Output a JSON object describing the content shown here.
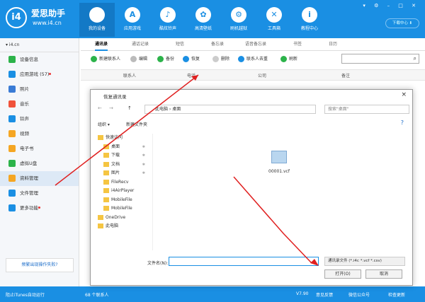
{
  "app": {
    "brand": "爱思助手",
    "url": "www.i4.cn",
    "logo": "i4",
    "download": "下载中心 ⬇",
    "window_controls": "▾ ⚙ – □ ✕"
  },
  "nav": [
    {
      "label": "我的设备",
      "icon": "apple-icon"
    },
    {
      "label": "应用游戏",
      "icon": "apps-icon"
    },
    {
      "label": "酷炫铃声",
      "icon": "bell-icon"
    },
    {
      "label": "高清壁纸",
      "icon": "wallpaper-icon"
    },
    {
      "label": "刷机越狱",
      "icon": "flash-icon"
    },
    {
      "label": "工具箱",
      "icon": "tools-icon"
    },
    {
      "label": "教程中心",
      "icon": "info-icon"
    }
  ],
  "sidebar": {
    "device": "▾ i4.cn",
    "help": "频繁出现操作失败?",
    "items": [
      {
        "label": "设备信息",
        "color": "#2cb34a"
      },
      {
        "label": "应用游戏 (57)",
        "color": "#1a8fe3",
        "dot": true
      },
      {
        "label": "照片",
        "color": "#3a7bd5"
      },
      {
        "label": "音乐",
        "color": "#f0523a"
      },
      {
        "label": "铃声",
        "color": "#1a8fe3"
      },
      {
        "label": "视频",
        "color": "#f5a623"
      },
      {
        "label": "电子书",
        "color": "#f5a623"
      },
      {
        "label": "虚拟U盘",
        "color": "#2cb34a"
      },
      {
        "label": "资料管理",
        "color": "#f5a623"
      },
      {
        "label": "文件管理",
        "color": "#1a8fe3"
      },
      {
        "label": "更多功能",
        "color": "#1a8fe3",
        "dot": true
      }
    ]
  },
  "tabs": [
    "通讯录",
    "通话记录",
    "短信",
    "备忘录",
    "语音备忘录",
    "书签",
    "日历"
  ],
  "toolbar": [
    "新建联系人",
    "编辑",
    "备份",
    "恢复",
    "删除",
    "联系人去重",
    "刷新"
  ],
  "table_headers": [
    "联系人",
    "电话",
    "公司",
    "备注"
  ],
  "status": {
    "itunes": "阻止iTunes自动运行",
    "count": "68 个联系人",
    "version": "V7.90",
    "feedback": "意见反馈",
    "wechat": "微信公众号",
    "update": "检查更新"
  },
  "dialog": {
    "title": "恢复通讯录",
    "path": "此电脑 › 桌面",
    "search_placeholder": "搜索\"桌面\"",
    "organize": "组织 ▾",
    "new_folder": "新建文件夹",
    "tree": [
      {
        "label": "快速访问",
        "icon": "star-icon"
      },
      {
        "label": "桌面",
        "icon": "desktop-icon",
        "pin": true
      },
      {
        "label": "下载",
        "icon": "download-icon",
        "pin": true
      },
      {
        "label": "文档",
        "icon": "document-icon",
        "pin": true
      },
      {
        "label": "图片",
        "icon": "picture-icon",
        "pin": true
      },
      {
        "label": "FileRecv",
        "icon": "folder-icon"
      },
      {
        "label": "i4AirPlayer",
        "icon": "folder-icon"
      },
      {
        "label": "MobileFile",
        "icon": "folder-icon"
      },
      {
        "label": "MobileFile",
        "icon": "folder-icon"
      },
      {
        "label": "OneDrive",
        "icon": "cloud-icon"
      },
      {
        "label": "此电脑",
        "icon": "pc-icon"
      }
    ],
    "file": "00001.vcf",
    "filename_label": "文件名(N):",
    "filetype": "通讯录文件 (*.i4c *.vcf *.csv)",
    "open": "打开(O)",
    "cancel": "取消"
  }
}
